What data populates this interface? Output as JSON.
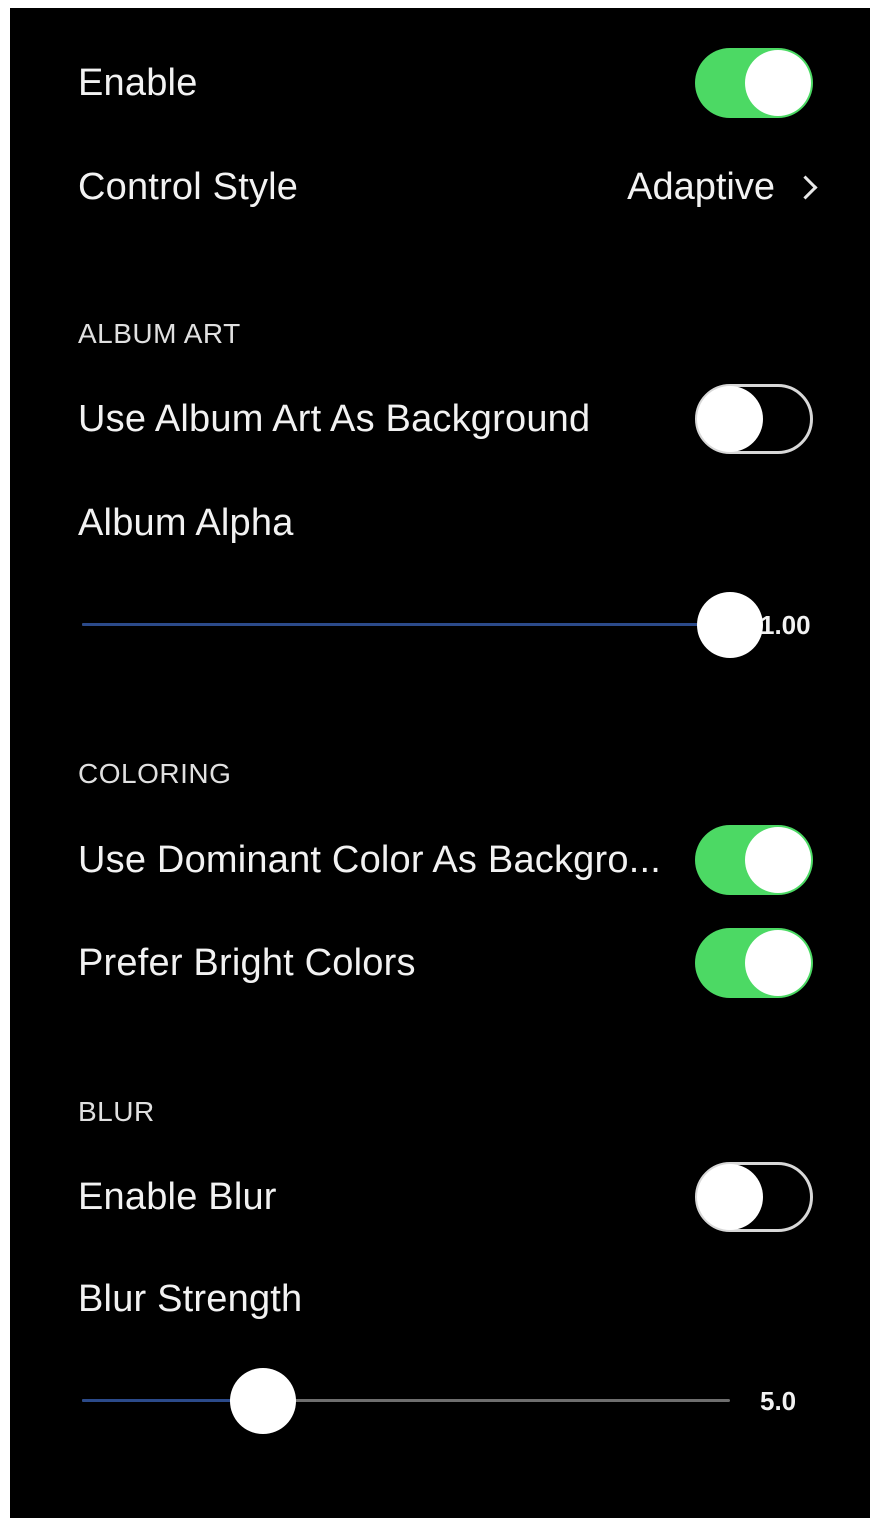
{
  "enable": {
    "label": "Enable",
    "on": true
  },
  "control_style": {
    "label": "Control Style",
    "value": "Adaptive"
  },
  "album_art": {
    "header": "ALBUM ART",
    "use_as_background": {
      "label": "Use Album Art As Background",
      "on": false
    },
    "alpha": {
      "label": "Album Alpha",
      "value_text": "1.00",
      "fraction": 1.0
    }
  },
  "coloring": {
    "header": "COLORING",
    "dominant_color": {
      "label": "Use Dominant Color As Backgro...",
      "on": true
    },
    "bright_colors": {
      "label": "Prefer Bright Colors",
      "on": true
    }
  },
  "blur": {
    "header": "BLUR",
    "enable_blur": {
      "label": "Enable Blur",
      "on": false
    },
    "strength": {
      "label": "Blur Strength",
      "value_text": "5.0",
      "fraction": 0.28
    }
  },
  "colors": {
    "toggle_on": "#4cd964",
    "background": "#000000",
    "slider_fill": "#2b4a8a"
  }
}
